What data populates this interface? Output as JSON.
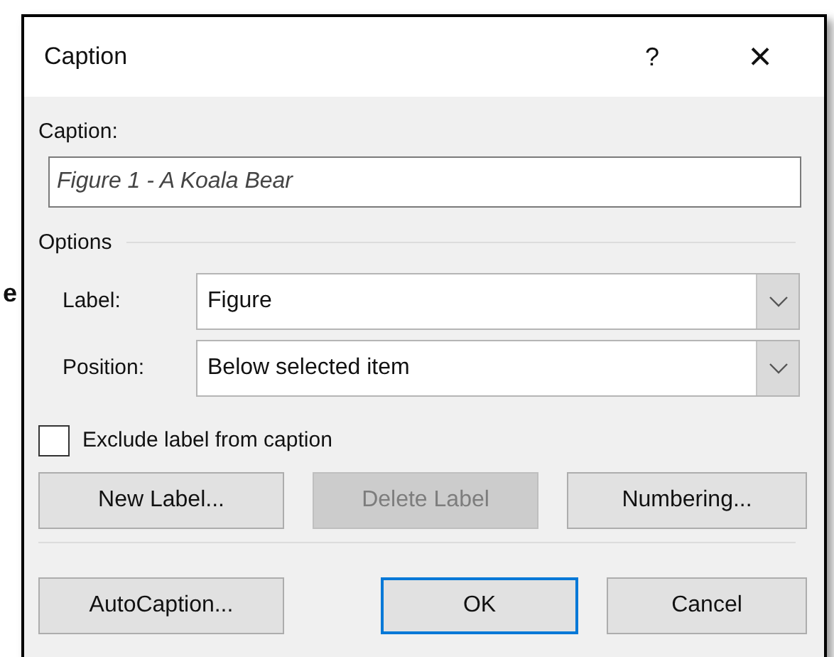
{
  "background_text": "e",
  "window": {
    "title": "Caption",
    "help": "?",
    "close": "×"
  },
  "caption": {
    "label": "Caption:",
    "value": "Figure 1 - A Koala Bear"
  },
  "options": {
    "title": "Options",
    "fields": [
      {
        "label": "Label:",
        "value": "Figure"
      },
      {
        "label": "Position:",
        "value": "Below selected item"
      }
    ]
  },
  "exclude_label": {
    "label": "Exclude label from caption",
    "checked": false
  },
  "label_buttons": [
    {
      "label": "New Label...",
      "disabled": false
    },
    {
      "label": "Delete Label",
      "disabled": true
    },
    {
      "label": "Numbering...",
      "disabled": false
    }
  ],
  "buttons": [
    {
      "label": "AutoCaption...",
      "default": false
    },
    {
      "label": "OK",
      "default": true
    },
    {
      "label": "Cancel",
      "default": false
    }
  ]
}
